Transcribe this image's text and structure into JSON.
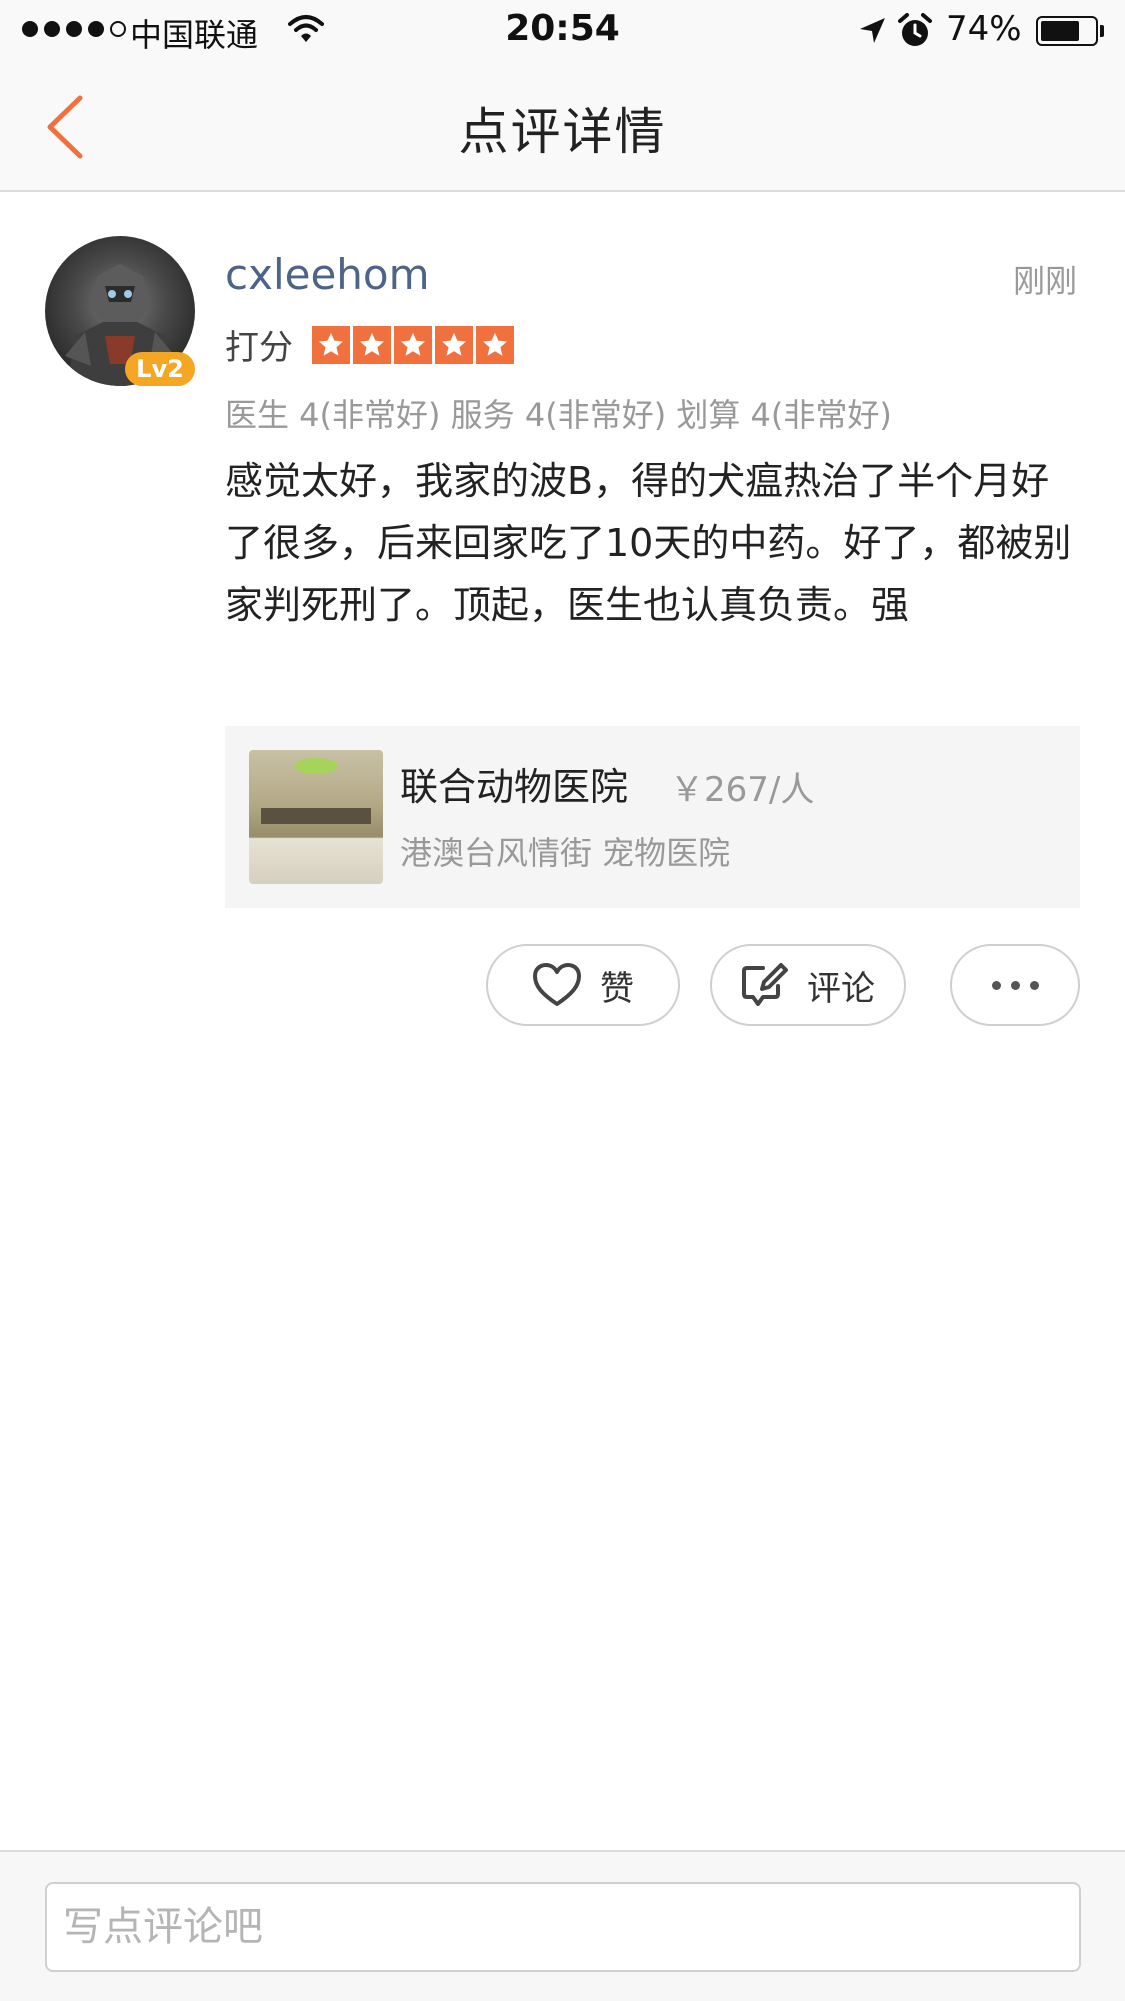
{
  "status_bar": {
    "carrier": "中国联通",
    "time": "20:54",
    "battery": "74%",
    "battery_level": 0.74
  },
  "nav": {
    "title": "点评详情"
  },
  "review": {
    "username": "cxleehom",
    "level": "Lv2",
    "time": "刚刚",
    "rating_label": "打分",
    "stars": 5,
    "star_color": "#f0703e",
    "sub_scores": "医生 4(非常好) 服务 4(非常好) 划算 4(非常好)",
    "text": "感觉太好，我家的波B，得的犬瘟热治了半个月好了很多，后来回家吃了10天的中药。好了，都被别家判死刑了。顶起，医生也认真负责。强"
  },
  "shop": {
    "name": "联合动物医院",
    "price": "￥267/人",
    "meta": "港澳台风情街 宠物医院"
  },
  "actions": {
    "like_label": "赞",
    "comment_label": "评论"
  },
  "comment_input": {
    "placeholder": "写点评论吧"
  }
}
